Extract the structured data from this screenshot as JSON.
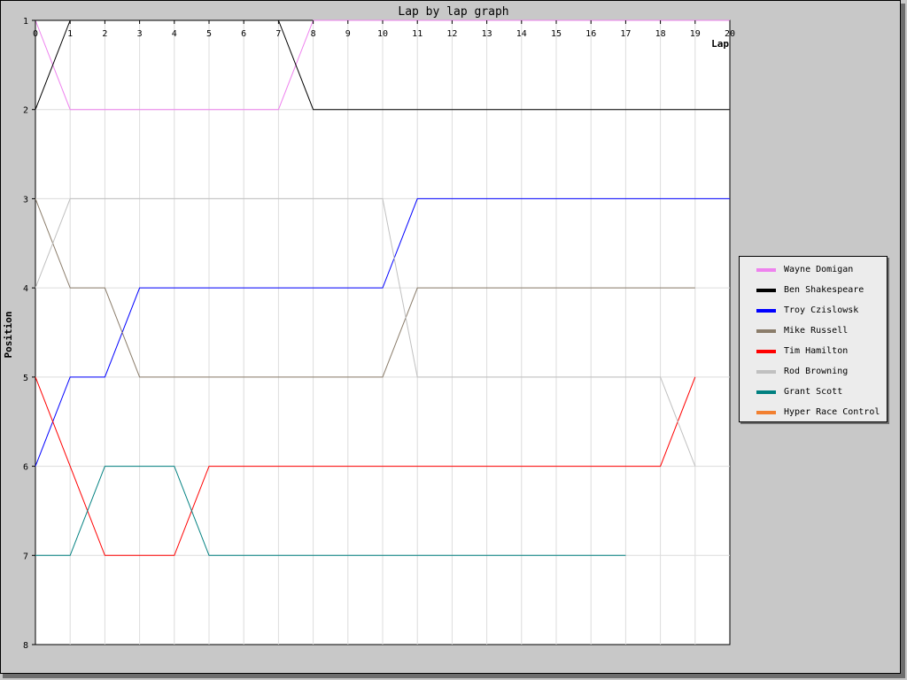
{
  "chart_data": {
    "type": "line",
    "title": "Lap by lap graph",
    "xlabel": "Lap",
    "ylabel": "Position",
    "xlim": [
      0,
      20
    ],
    "ylim": [
      1,
      8
    ],
    "y_inverted": true,
    "x_ticks": [
      "0",
      "1",
      "2",
      "3",
      "4",
      "5",
      "6",
      "7",
      "8",
      "9",
      "10",
      "11",
      "12",
      "13",
      "14",
      "15",
      "16",
      "17",
      "18",
      "19",
      "20"
    ],
    "y_ticks": [
      "1",
      "2",
      "3",
      "4",
      "5",
      "6",
      "7",
      "8"
    ],
    "grid": true,
    "legend_position": "right",
    "series": [
      {
        "name": "Wayne Domigan",
        "color": "#ee82ee",
        "x": [
          0,
          1,
          2,
          3,
          4,
          5,
          6,
          7,
          8,
          9,
          10,
          11,
          12,
          13,
          14,
          15,
          16,
          17,
          18,
          19,
          20
        ],
        "values": [
          1,
          2,
          2,
          2,
          2,
          2,
          2,
          2,
          1,
          1,
          1,
          1,
          1,
          1,
          1,
          1,
          1,
          1,
          1,
          1,
          1
        ]
      },
      {
        "name": "Ben Shakespeare",
        "color": "#000000",
        "x": [
          0,
          1,
          2,
          3,
          4,
          5,
          6,
          7,
          8,
          9,
          10,
          11,
          12,
          13,
          14,
          15,
          16,
          17,
          18,
          19,
          20
        ],
        "values": [
          2,
          1,
          1,
          1,
          1,
          1,
          1,
          1,
          2,
          2,
          2,
          2,
          2,
          2,
          2,
          2,
          2,
          2,
          2,
          2,
          2
        ]
      },
      {
        "name": "Troy Czislowsk",
        "color": "#0000ff",
        "x": [
          0,
          1,
          2,
          3,
          4,
          5,
          6,
          7,
          8,
          9,
          10,
          11,
          12,
          13,
          14,
          15,
          16,
          17,
          18,
          19,
          20
        ],
        "values": [
          6,
          5,
          5,
          4,
          4,
          4,
          4,
          4,
          4,
          4,
          4,
          3,
          3,
          3,
          3,
          3,
          3,
          3,
          3,
          3,
          3
        ]
      },
      {
        "name": "Mike Russell",
        "color": "#8b7d6b",
        "x": [
          0,
          1,
          2,
          3,
          4,
          5,
          6,
          7,
          8,
          9,
          10,
          11,
          12,
          13,
          14,
          15,
          16,
          17,
          18,
          19
        ],
        "values": [
          3,
          4,
          4,
          5,
          5,
          5,
          5,
          5,
          5,
          5,
          5,
          4,
          4,
          4,
          4,
          4,
          4,
          4,
          4,
          4
        ]
      },
      {
        "name": "Tim Hamilton",
        "color": "#ff0000",
        "x": [
          0,
          1,
          2,
          3,
          4,
          5,
          6,
          7,
          8,
          9,
          10,
          11,
          12,
          13,
          14,
          15,
          16,
          17,
          18,
          19
        ],
        "values": [
          5,
          6,
          7,
          7,
          7,
          6,
          6,
          6,
          6,
          6,
          6,
          6,
          6,
          6,
          6,
          6,
          6,
          6,
          6,
          5
        ]
      },
      {
        "name": "Rod Browning",
        "color": "#c0c0c0",
        "x": [
          0,
          1,
          2,
          3,
          4,
          5,
          6,
          7,
          8,
          9,
          10,
          11,
          12,
          13,
          14,
          15,
          16,
          17,
          18,
          19
        ],
        "values": [
          4,
          3,
          3,
          3,
          3,
          3,
          3,
          3,
          3,
          3,
          3,
          5,
          5,
          5,
          5,
          5,
          5,
          5,
          5,
          6
        ]
      },
      {
        "name": "Grant Scott",
        "color": "#008080",
        "x": [
          0,
          1,
          2,
          3,
          4,
          5,
          6,
          7,
          8,
          9,
          10,
          11,
          12,
          13,
          14,
          15,
          16,
          17
        ],
        "values": [
          7,
          7,
          6,
          6,
          6,
          7,
          7,
          7,
          7,
          7,
          7,
          7,
          7,
          7,
          7,
          7,
          7,
          7
        ]
      },
      {
        "name": "Hyper Race Control",
        "color": "#f28030",
        "x": [],
        "values": []
      }
    ]
  }
}
